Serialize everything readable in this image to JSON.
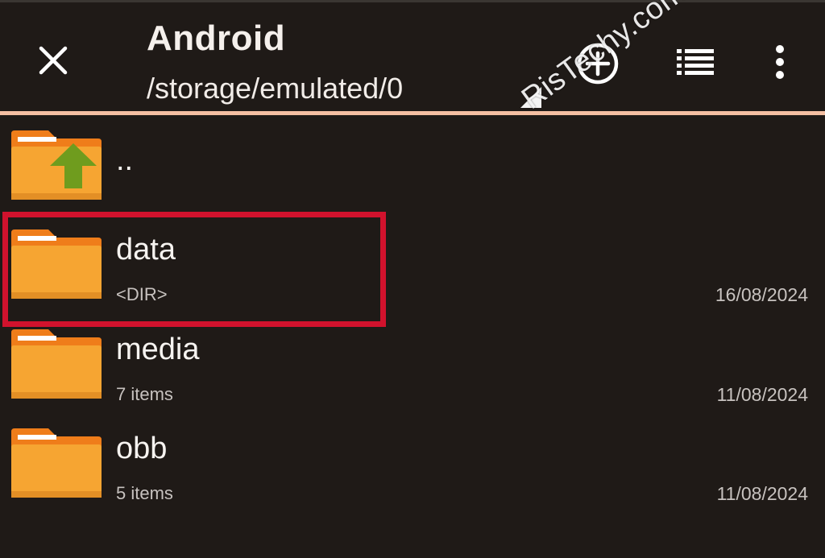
{
  "header": {
    "title": "Android",
    "path": "/storage/emulated/0",
    "icons": {
      "close": "close-icon",
      "add": "add-circle-icon",
      "view": "list-view-icon",
      "more": "more-vertical-icon"
    }
  },
  "items": [
    {
      "name": "..",
      "sub": "",
      "date": "",
      "icon": "folder-up-icon"
    },
    {
      "name": "data",
      "sub": "<DIR>",
      "date": "16/08/2024",
      "icon": "folder-icon"
    },
    {
      "name": "media",
      "sub": "7 items",
      "date": "11/08/2024",
      "icon": "folder-icon"
    },
    {
      "name": "obb",
      "sub": "5 items",
      "date": "11/08/2024",
      "icon": "folder-icon"
    }
  ],
  "watermark": "RisTechy.com",
  "colors": {
    "background": "#1f1a17",
    "accent_line": "#f4bfa2",
    "folder_body": "#f6a532",
    "folder_tab": "#ef7d1a",
    "up_arrow": "#6f9c1e",
    "highlight": "#d1122d"
  }
}
